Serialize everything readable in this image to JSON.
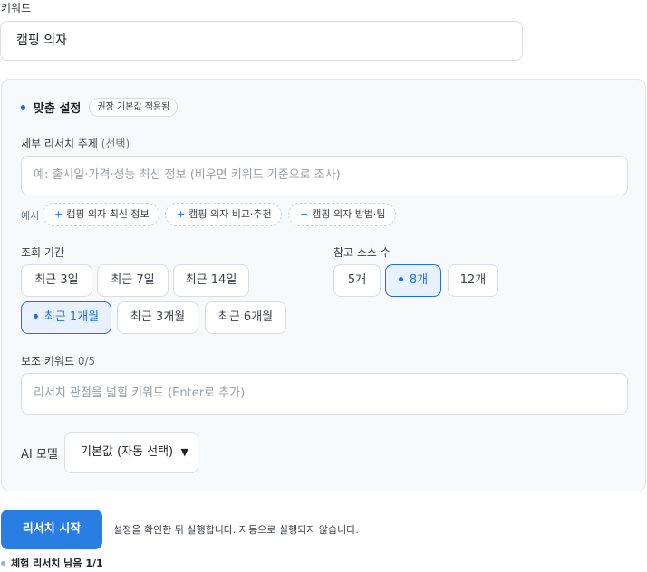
{
  "keyword": {
    "label": "키워드",
    "value": "캠핑 의자"
  },
  "panel": {
    "title": "맞춤 설정",
    "badge": "권장 기본값 적용됨",
    "subtopic": {
      "label": "세부 리서치 주제",
      "label_suffix": "(선택)",
      "placeholder": "예: 출시일·가격·성능 최신 정보 (비우면 키워드 기준으로 조사)"
    },
    "examples": {
      "label": "예시",
      "chips": [
        "캠핑 의자 최신 정보",
        "캠핑 의자 비교·추천",
        "캠핑 의자 방법·팁"
      ]
    },
    "period": {
      "label": "조회 기간",
      "options": [
        "최근 3일",
        "최근 7일",
        "최근 14일",
        "최근 1개월",
        "최근 3개월",
        "최근 6개월"
      ],
      "selected": "최근 1개월"
    },
    "sources": {
      "label": "참고 소스 수",
      "options": [
        "5개",
        "8개",
        "12개"
      ],
      "selected": "8개"
    },
    "aux_keywords": {
      "label": "보조 키워드",
      "count": "0/5",
      "placeholder": "리서치 관점을 넓힐 키워드 (Enter로 추가)"
    },
    "ai_model": {
      "label": "AI 모델",
      "selected": "기본값 (자동 선택)"
    }
  },
  "actions": {
    "start_label": "리서치 시작",
    "hint": "설정을 확인한 뒤 실행합니다. 자동으로 실행되지 않습니다.",
    "remaining": "체험 리서치 남음 1/1"
  },
  "colors": {
    "accent": "#1f6fe5",
    "start_button": "#2a7de1"
  }
}
